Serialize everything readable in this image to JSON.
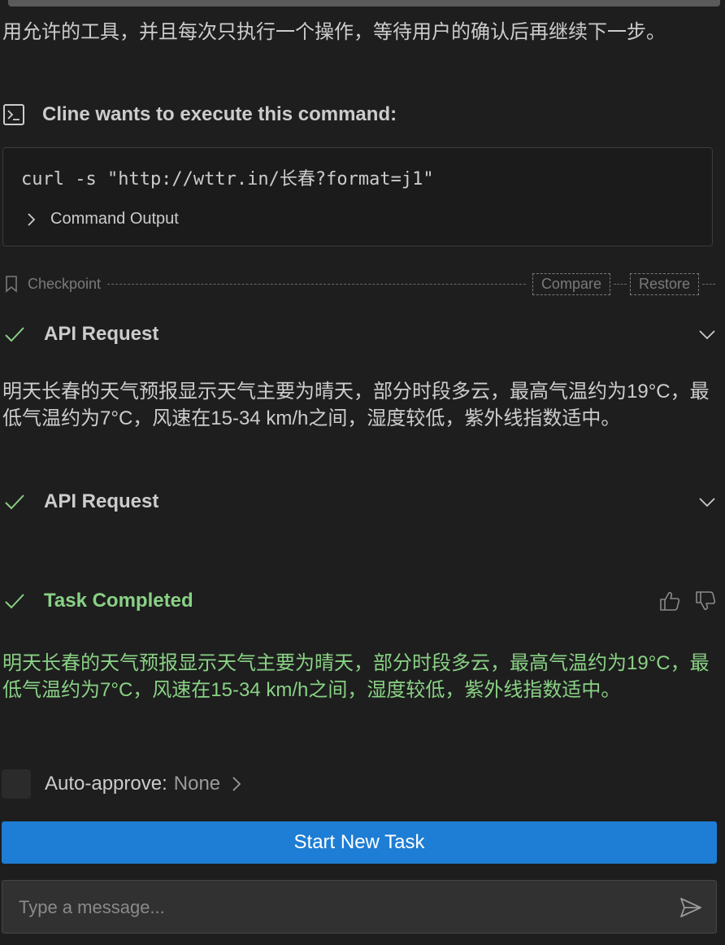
{
  "intro": {
    "text": "用允许的工具，并且每次只执行一个操作，等待用户的确认后再继续下一步。"
  },
  "command": {
    "header": "Cline wants to execute this command:",
    "icon": "terminal-icon",
    "text": "curl -s \"http://wttr.in/长春?format=j1\"",
    "output_label": "Command Output"
  },
  "checkpoint": {
    "label": "Checkpoint",
    "compare_label": "Compare",
    "restore_label": "Restore"
  },
  "api_request_1": {
    "label": "API Request"
  },
  "message_1": {
    "text": "明天长春的天气预报显示天气主要为晴天，部分时段多云，最高气温约为19°C，最低气温约为7°C，风速在15-34 km/h之间，湿度较低，紫外线指数适中。"
  },
  "api_request_2": {
    "label": "API Request"
  },
  "task": {
    "label": "Task Completed",
    "text": "明天长春的天气预报显示天气主要为晴天，部分时段多云，最高气温约为19°C，最低气温约为7°C，风速在15-34 km/h之间，湿度较低，紫外线指数适中。"
  },
  "auto_approve": {
    "label": "Auto-approve:",
    "value": "None"
  },
  "start_button": {
    "label": "Start New Task"
  },
  "input": {
    "placeholder": "Type a message..."
  },
  "colors": {
    "background": "#1e1e1e",
    "text": "#cccccc",
    "success": "#89d185",
    "primary_button": "#1e7dd4",
    "input_bg": "#313131"
  }
}
